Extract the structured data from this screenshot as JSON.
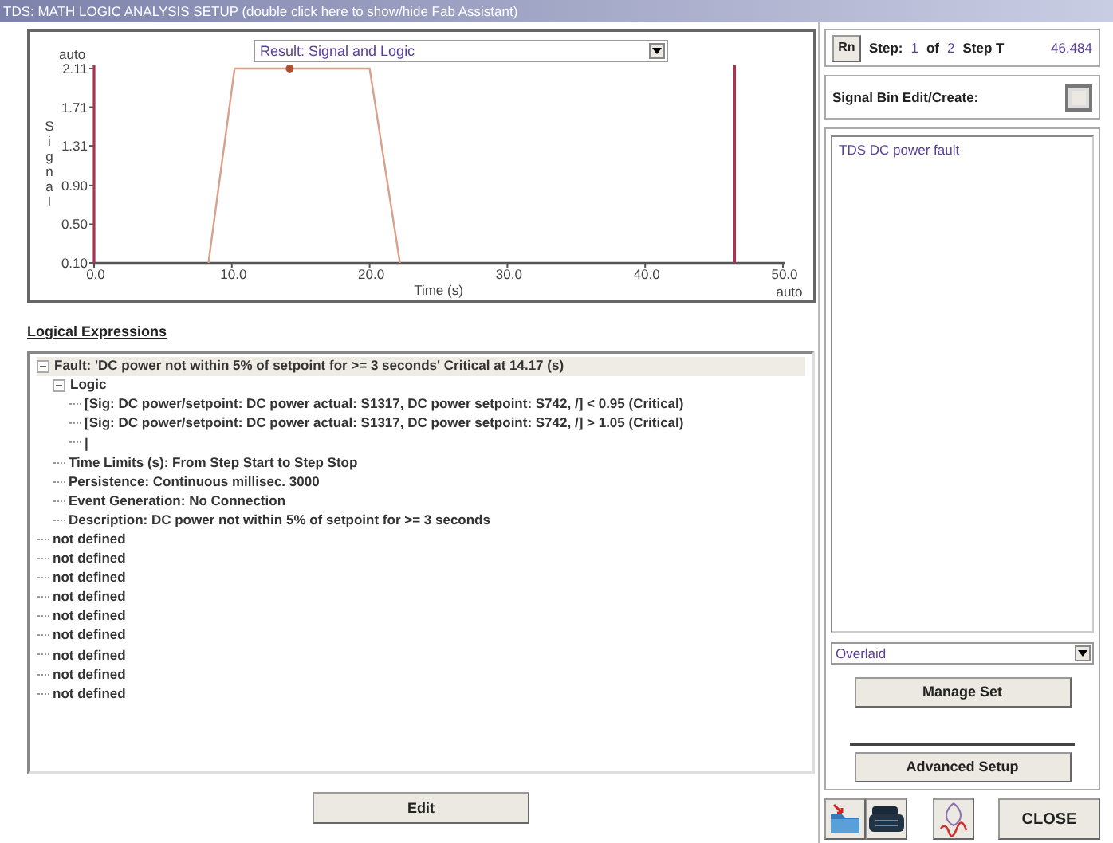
{
  "window": {
    "title": "TDS: MATH LOGIC ANALYSIS SETUP  (double click here to show/hide Fab Assistant)"
  },
  "chart": {
    "result_dropdown": "Result: Signal and Logic",
    "y_auto": "auto",
    "x_auto": "auto",
    "chart_data": {
      "type": "line",
      "xlabel": "Time (s)",
      "ylabel": "Signal",
      "xlim": [
        0,
        50
      ],
      "ylim": [
        0.1,
        2.11
      ],
      "xticks": [
        {
          "value": 0,
          "label": "0.0"
        },
        {
          "value": 10,
          "label": "10.0"
        },
        {
          "value": 20,
          "label": "20.0"
        },
        {
          "value": 30,
          "label": "30.0"
        },
        {
          "value": 40,
          "label": "40.0"
        },
        {
          "value": 50,
          "label": "50.0"
        }
      ],
      "yticks": [
        {
          "value": 0.1,
          "label": "0.10"
        },
        {
          "value": 0.5,
          "label": "0.50"
        },
        {
          "value": 0.9,
          "label": "0.90"
        },
        {
          "value": 1.31,
          "label": "1.31"
        },
        {
          "value": 1.71,
          "label": "1.71"
        },
        {
          "value": 2.11,
          "label": "2.11"
        }
      ],
      "x": [
        8.3,
        10.2,
        20.0,
        22.2
      ],
      "series": [
        {
          "color": "#d9a08c",
          "values": [
            0.1,
            2.11,
            2.11,
            0.1
          ]
        }
      ],
      "ref_lines": [
        {
          "axis": "x",
          "value": 0,
          "color": "#b03050"
        },
        {
          "axis": "x",
          "value": 46.5,
          "color": "#b03050"
        }
      ]
    }
  },
  "logic": {
    "heading": "Logical Expressions",
    "tree": [
      {
        "text": "Fault: 'DC power not within 5% of setpoint for >= 3 seconds' Critical at 14.17 (s)",
        "expanded": true,
        "children": [
          {
            "text": "Logic",
            "expanded": true,
            "children": [
              {
                "text": "[Sig: DC power/setpoint: DC power actual: S1317, DC power setpoint: S742, /] < 0.95 (Critical)"
              },
              {
                "text": "[Sig: DC power/setpoint: DC power actual: S1317, DC power setpoint: S742, /] > 1.05 (Critical)"
              },
              {
                "text": "|"
              }
            ]
          },
          {
            "text": "Time Limits (s):   From Step Start to Step Stop"
          },
          {
            "text": "Persistence: Continuous millisec. 3000"
          },
          {
            "text": "Event Generation: No Connection"
          },
          {
            "text": "Description: DC power not within 5% of setpoint for >= 3 seconds"
          }
        ]
      },
      {
        "text": "not defined"
      },
      {
        "text": "not defined"
      },
      {
        "text": "not defined"
      },
      {
        "text": "not defined"
      },
      {
        "text": "not defined"
      },
      {
        "text": "not defined"
      },
      {
        "text": "not defined"
      },
      {
        "text": "not defined"
      },
      {
        "text": "not defined"
      }
    ],
    "edit_button": "Edit"
  },
  "step": {
    "button": "Rn",
    "label": "Step:",
    "current": "1",
    "of": "of",
    "total": "2",
    "time_label": "Step T",
    "time": "46.484"
  },
  "signal_bin": {
    "label": "Signal Bin Edit/Create:"
  },
  "bin_list": [
    "TDS DC power fault"
  ],
  "display_mode": {
    "value": "Overlaid"
  },
  "manage_button": "Manage Set",
  "advanced_button": "Advanced Setup",
  "close_button": "CLOSE"
}
